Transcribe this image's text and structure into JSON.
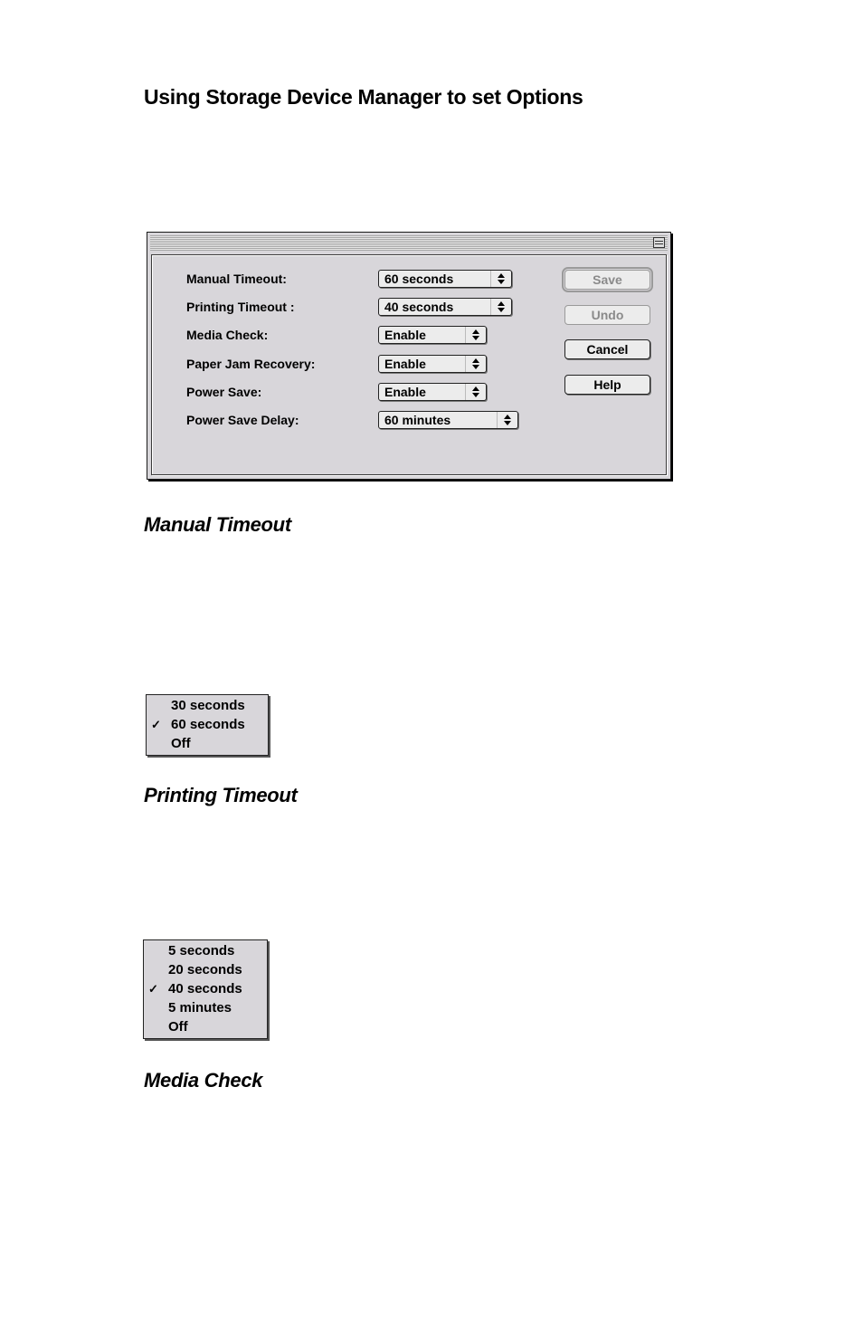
{
  "page": {
    "heading": "Using Storage Device Manager to set Options",
    "sections": [
      {
        "title": "Manual Timeout"
      },
      {
        "title": "Printing Timeout"
      },
      {
        "title": "Media Check"
      }
    ]
  },
  "dialog": {
    "rows": [
      {
        "label": "Manual Timeout:",
        "value": "60 seconds"
      },
      {
        "label": "Printing Timeout :",
        "value": "40 seconds"
      },
      {
        "label": "Media Check:",
        "value": "Enable"
      },
      {
        "label": "Paper Jam Recovery:",
        "value": "Enable"
      },
      {
        "label": "Power Save:",
        "value": "Enable"
      },
      {
        "label": "Power Save Delay:",
        "value": "60 minutes"
      }
    ],
    "buttons": {
      "save": "Save",
      "undo": "Undo",
      "cancel": "Cancel",
      "help": "Help"
    },
    "arrow_glyph": "▲\n▼"
  },
  "menus": {
    "manual_timeout": {
      "items": [
        "30 seconds",
        "60 seconds",
        "Off"
      ],
      "checked_index": 1
    },
    "printing_timeout": {
      "items": [
        "5 seconds",
        "20 seconds",
        "40 seconds",
        "5 minutes",
        "Off"
      ],
      "checked_index": 2
    },
    "check_glyph": "✓"
  }
}
